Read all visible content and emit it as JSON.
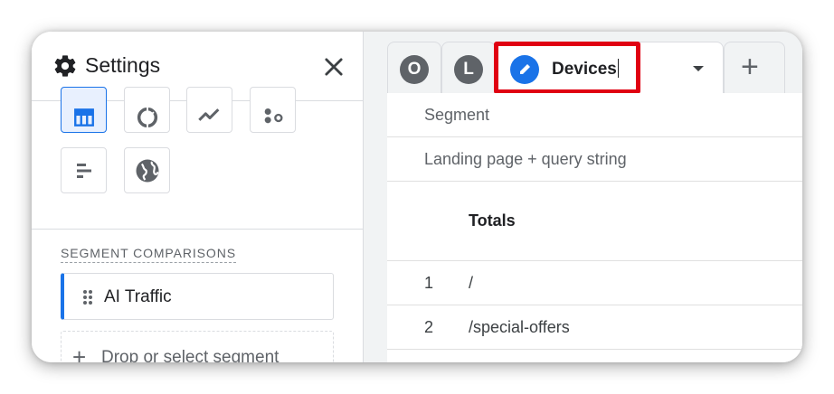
{
  "panel": {
    "title": "Settings",
    "icons": {
      "settings": "gear-icon",
      "close": "close-icon"
    },
    "visualizations": [
      {
        "name": "table-icon",
        "selected": true
      },
      {
        "name": "donut-chart-icon",
        "selected": false
      },
      {
        "name": "line-chart-icon",
        "selected": false
      },
      {
        "name": "scatter-plot-icon",
        "selected": false
      },
      {
        "name": "bar-chart-icon",
        "selected": false
      },
      {
        "name": "globe-icon",
        "selected": false
      }
    ],
    "segment_comparisons_label": "SEGMENT COMPARISONS",
    "segment": {
      "label": "AI Traffic"
    },
    "drop_zone": {
      "plus": "+",
      "label": "Drop or select segment"
    }
  },
  "tabs": {
    "avatars": [
      "O",
      "L"
    ],
    "active": {
      "value": "Devices"
    },
    "add_tab": "+"
  },
  "table": {
    "segment_label": "Segment",
    "dimension_label": "Landing page + query string",
    "totals_label": "Totals",
    "rows": [
      {
        "index": "1",
        "path": "/"
      },
      {
        "index": "2",
        "path": "/special-offers"
      }
    ]
  },
  "colors": {
    "accent": "#1a73e8",
    "highlight": "#e00012",
    "icon": "#5f6368"
  }
}
